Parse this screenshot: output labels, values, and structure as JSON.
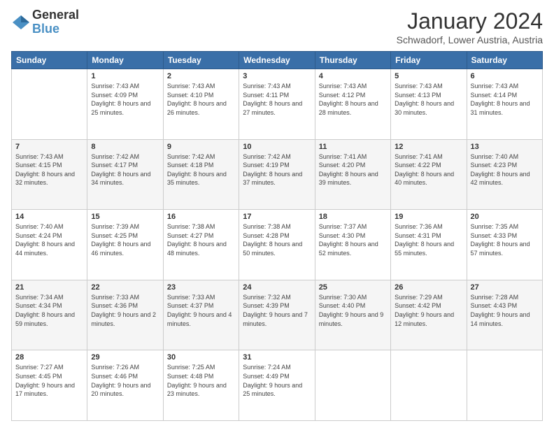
{
  "logo": {
    "general": "General",
    "blue": "Blue"
  },
  "header": {
    "month": "January 2024",
    "location": "Schwadorf, Lower Austria, Austria"
  },
  "weekdays": [
    "Sunday",
    "Monday",
    "Tuesday",
    "Wednesday",
    "Thursday",
    "Friday",
    "Saturday"
  ],
  "weeks": [
    [
      {
        "day": "",
        "sunrise": "",
        "sunset": "",
        "daylight": ""
      },
      {
        "day": "1",
        "sunrise": "Sunrise: 7:43 AM",
        "sunset": "Sunset: 4:09 PM",
        "daylight": "Daylight: 8 hours and 25 minutes."
      },
      {
        "day": "2",
        "sunrise": "Sunrise: 7:43 AM",
        "sunset": "Sunset: 4:10 PM",
        "daylight": "Daylight: 8 hours and 26 minutes."
      },
      {
        "day": "3",
        "sunrise": "Sunrise: 7:43 AM",
        "sunset": "Sunset: 4:11 PM",
        "daylight": "Daylight: 8 hours and 27 minutes."
      },
      {
        "day": "4",
        "sunrise": "Sunrise: 7:43 AM",
        "sunset": "Sunset: 4:12 PM",
        "daylight": "Daylight: 8 hours and 28 minutes."
      },
      {
        "day": "5",
        "sunrise": "Sunrise: 7:43 AM",
        "sunset": "Sunset: 4:13 PM",
        "daylight": "Daylight: 8 hours and 30 minutes."
      },
      {
        "day": "6",
        "sunrise": "Sunrise: 7:43 AM",
        "sunset": "Sunset: 4:14 PM",
        "daylight": "Daylight: 8 hours and 31 minutes."
      }
    ],
    [
      {
        "day": "7",
        "sunrise": "Sunrise: 7:43 AM",
        "sunset": "Sunset: 4:15 PM",
        "daylight": "Daylight: 8 hours and 32 minutes."
      },
      {
        "day": "8",
        "sunrise": "Sunrise: 7:42 AM",
        "sunset": "Sunset: 4:17 PM",
        "daylight": "Daylight: 8 hours and 34 minutes."
      },
      {
        "day": "9",
        "sunrise": "Sunrise: 7:42 AM",
        "sunset": "Sunset: 4:18 PM",
        "daylight": "Daylight: 8 hours and 35 minutes."
      },
      {
        "day": "10",
        "sunrise": "Sunrise: 7:42 AM",
        "sunset": "Sunset: 4:19 PM",
        "daylight": "Daylight: 8 hours and 37 minutes."
      },
      {
        "day": "11",
        "sunrise": "Sunrise: 7:41 AM",
        "sunset": "Sunset: 4:20 PM",
        "daylight": "Daylight: 8 hours and 39 minutes."
      },
      {
        "day": "12",
        "sunrise": "Sunrise: 7:41 AM",
        "sunset": "Sunset: 4:22 PM",
        "daylight": "Daylight: 8 hours and 40 minutes."
      },
      {
        "day": "13",
        "sunrise": "Sunrise: 7:40 AM",
        "sunset": "Sunset: 4:23 PM",
        "daylight": "Daylight: 8 hours and 42 minutes."
      }
    ],
    [
      {
        "day": "14",
        "sunrise": "Sunrise: 7:40 AM",
        "sunset": "Sunset: 4:24 PM",
        "daylight": "Daylight: 8 hours and 44 minutes."
      },
      {
        "day": "15",
        "sunrise": "Sunrise: 7:39 AM",
        "sunset": "Sunset: 4:25 PM",
        "daylight": "Daylight: 8 hours and 46 minutes."
      },
      {
        "day": "16",
        "sunrise": "Sunrise: 7:38 AM",
        "sunset": "Sunset: 4:27 PM",
        "daylight": "Daylight: 8 hours and 48 minutes."
      },
      {
        "day": "17",
        "sunrise": "Sunrise: 7:38 AM",
        "sunset": "Sunset: 4:28 PM",
        "daylight": "Daylight: 8 hours and 50 minutes."
      },
      {
        "day": "18",
        "sunrise": "Sunrise: 7:37 AM",
        "sunset": "Sunset: 4:30 PM",
        "daylight": "Daylight: 8 hours and 52 minutes."
      },
      {
        "day": "19",
        "sunrise": "Sunrise: 7:36 AM",
        "sunset": "Sunset: 4:31 PM",
        "daylight": "Daylight: 8 hours and 55 minutes."
      },
      {
        "day": "20",
        "sunrise": "Sunrise: 7:35 AM",
        "sunset": "Sunset: 4:33 PM",
        "daylight": "Daylight: 8 hours and 57 minutes."
      }
    ],
    [
      {
        "day": "21",
        "sunrise": "Sunrise: 7:34 AM",
        "sunset": "Sunset: 4:34 PM",
        "daylight": "Daylight: 8 hours and 59 minutes."
      },
      {
        "day": "22",
        "sunrise": "Sunrise: 7:33 AM",
        "sunset": "Sunset: 4:36 PM",
        "daylight": "Daylight: 9 hours and 2 minutes."
      },
      {
        "day": "23",
        "sunrise": "Sunrise: 7:33 AM",
        "sunset": "Sunset: 4:37 PM",
        "daylight": "Daylight: 9 hours and 4 minutes."
      },
      {
        "day": "24",
        "sunrise": "Sunrise: 7:32 AM",
        "sunset": "Sunset: 4:39 PM",
        "daylight": "Daylight: 9 hours and 7 minutes."
      },
      {
        "day": "25",
        "sunrise": "Sunrise: 7:30 AM",
        "sunset": "Sunset: 4:40 PM",
        "daylight": "Daylight: 9 hours and 9 minutes."
      },
      {
        "day": "26",
        "sunrise": "Sunrise: 7:29 AM",
        "sunset": "Sunset: 4:42 PM",
        "daylight": "Daylight: 9 hours and 12 minutes."
      },
      {
        "day": "27",
        "sunrise": "Sunrise: 7:28 AM",
        "sunset": "Sunset: 4:43 PM",
        "daylight": "Daylight: 9 hours and 14 minutes."
      }
    ],
    [
      {
        "day": "28",
        "sunrise": "Sunrise: 7:27 AM",
        "sunset": "Sunset: 4:45 PM",
        "daylight": "Daylight: 9 hours and 17 minutes."
      },
      {
        "day": "29",
        "sunrise": "Sunrise: 7:26 AM",
        "sunset": "Sunset: 4:46 PM",
        "daylight": "Daylight: 9 hours and 20 minutes."
      },
      {
        "day": "30",
        "sunrise": "Sunrise: 7:25 AM",
        "sunset": "Sunset: 4:48 PM",
        "daylight": "Daylight: 9 hours and 23 minutes."
      },
      {
        "day": "31",
        "sunrise": "Sunrise: 7:24 AM",
        "sunset": "Sunset: 4:49 PM",
        "daylight": "Daylight: 9 hours and 25 minutes."
      },
      {
        "day": "",
        "sunrise": "",
        "sunset": "",
        "daylight": ""
      },
      {
        "day": "",
        "sunrise": "",
        "sunset": "",
        "daylight": ""
      },
      {
        "day": "",
        "sunrise": "",
        "sunset": "",
        "daylight": ""
      }
    ]
  ]
}
